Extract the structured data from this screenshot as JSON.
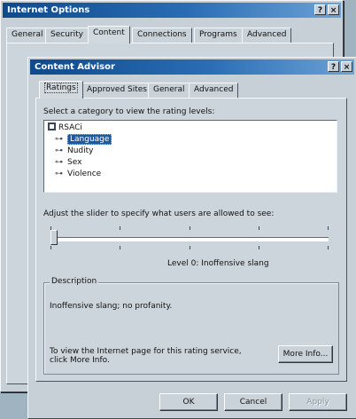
{
  "back_window": {
    "title": "Internet Options",
    "title_buttons": [
      "?",
      "×"
    ],
    "tabs": [
      "General",
      "Security",
      "Content",
      "Connections",
      "Programs",
      "Advanced"
    ]
  },
  "dialog": {
    "title": "Content Advisor",
    "title_buttons": [
      "?",
      "×"
    ],
    "tabs": [
      "Ratings",
      "Approved Sites",
      "General",
      "Advanced"
    ],
    "category_prompt": "Select a category to view the rating levels:",
    "tree": {
      "root": "RSACi",
      "items": [
        "Language",
        "Nudity",
        "Sex",
        "Violence"
      ],
      "selected": "Language"
    },
    "slider_prompt": "Adjust the slider to specify what users are allowed to see:",
    "slider": {
      "level_fraction": 0.0,
      "tick_count": 5
    },
    "level_text": "Level 0:  Inoffensive slang",
    "description_label": "Description",
    "description_text": "Inoffensive slang; no profanity.",
    "more_info_text_1": "To view the Internet page for this rating service,",
    "more_info_text_2": "click More Info.",
    "more_info_button": "More Info...",
    "buttons": {
      "ok": "OK",
      "cancel": "Cancel",
      "apply": "Apply"
    }
  }
}
